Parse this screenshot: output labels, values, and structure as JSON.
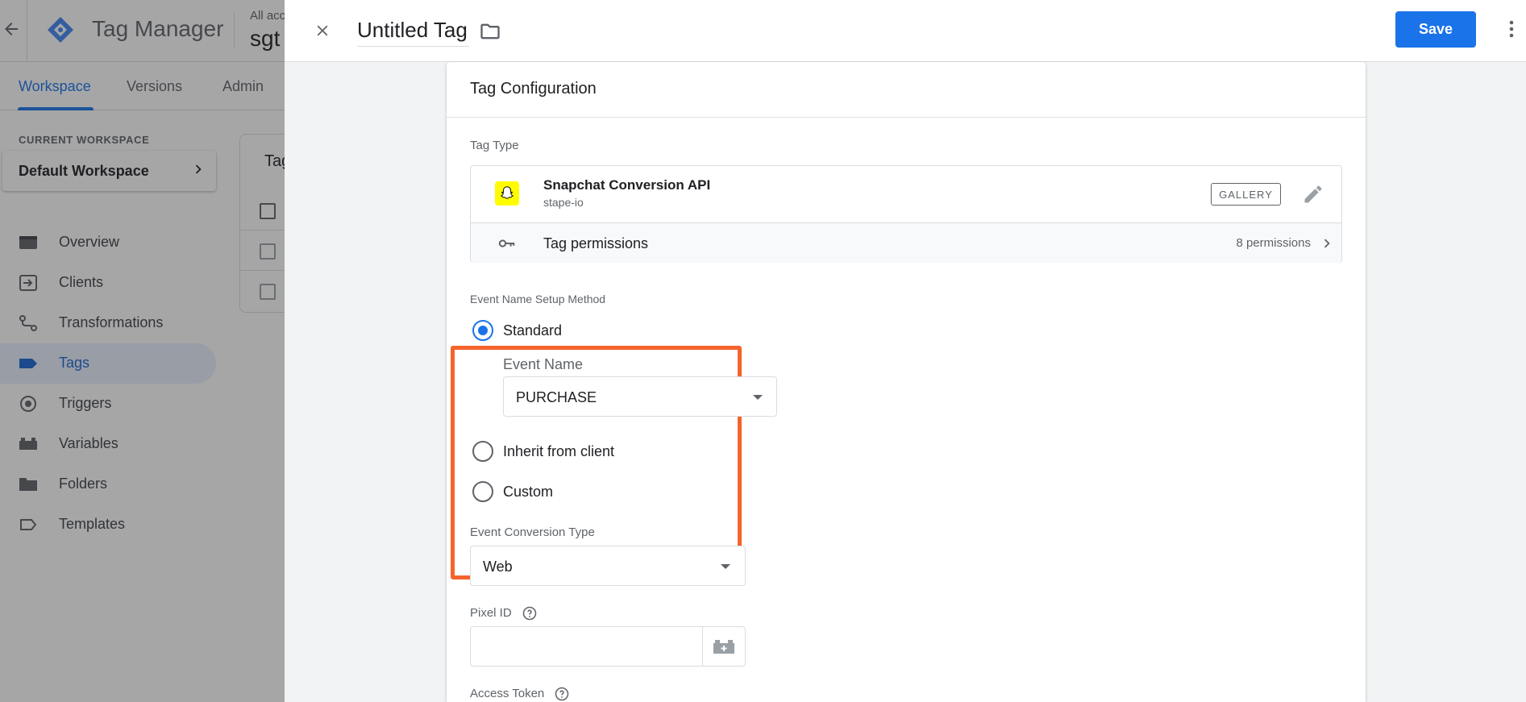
{
  "background": {
    "product_name": "Tag Manager",
    "account_small": "All acc",
    "account_big": "sgt",
    "tabs": [
      {
        "label": "Workspace",
        "active": true
      },
      {
        "label": "Versions",
        "active": false
      },
      {
        "label": "Admin",
        "active": false
      }
    ],
    "workspace_label": "CURRENT WORKSPACE",
    "workspace_name": "Default Workspace",
    "nav": [
      {
        "label": "Overview",
        "icon": "overview-icon",
        "active": false
      },
      {
        "label": "Clients",
        "icon": "clients-icon",
        "active": false
      },
      {
        "label": "Transformations",
        "icon": "transformations-icon",
        "active": false
      },
      {
        "label": "Tags",
        "icon": "tag-icon",
        "active": true
      },
      {
        "label": "Triggers",
        "icon": "triggers-icon",
        "active": false
      },
      {
        "label": "Variables",
        "icon": "variables-icon",
        "active": false
      },
      {
        "label": "Folders",
        "icon": "folder-icon",
        "active": false
      },
      {
        "label": "Templates",
        "icon": "templates-icon",
        "active": false
      }
    ],
    "list_title": "Tag"
  },
  "drawer": {
    "title": "Untitled Tag",
    "save_label": "Save"
  },
  "config": {
    "card_title": "Tag Configuration",
    "tag_type_label": "Tag Type",
    "tag_type": {
      "name": "Snapchat Conversion API",
      "vendor": "stape-io",
      "gallery_label": "GALLERY",
      "permissions_label": "Tag permissions",
      "permissions_count": "8 permissions"
    },
    "event_name_method": {
      "label": "Event Name Setup Method",
      "options": [
        {
          "label": "Standard",
          "checked": true
        },
        {
          "label": "Inherit from client",
          "checked": false
        },
        {
          "label": "Custom",
          "checked": false
        }
      ],
      "event_name_label": "Event Name",
      "event_name_value": "PURCHASE"
    },
    "event_conversion_type": {
      "label": "Event Conversion Type",
      "value": "Web"
    },
    "pixel_id": {
      "label": "Pixel ID",
      "value": ""
    },
    "access_token": {
      "label": "Access Token"
    },
    "highlight_color": "#f4642c",
    "accent_color": "#1a73e8",
    "brand_color": "#fffc00"
  }
}
